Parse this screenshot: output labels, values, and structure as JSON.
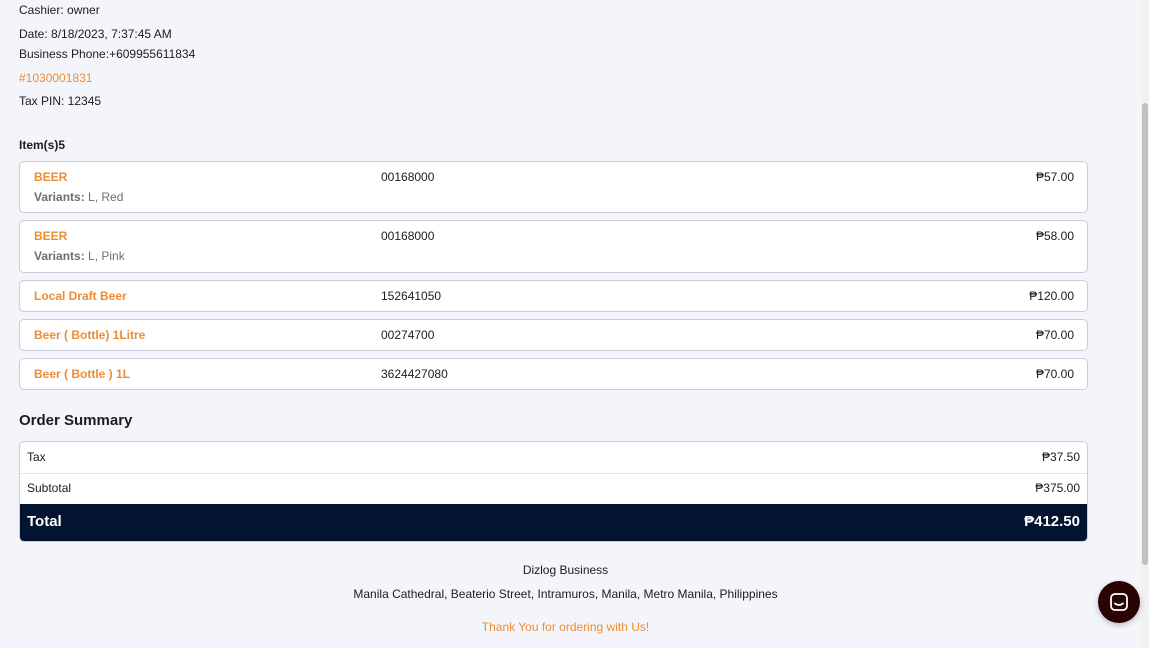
{
  "receipt": {
    "cashier": "Cashier: owner",
    "date": "Date: 8/18/2023, 7:37:45 AM",
    "phone": "Business Phone:+609955611834",
    "order_number": "#1030001831",
    "tax_pin": "Tax PIN: 12345"
  },
  "items_title": "Item(s)5",
  "variants_label": "Variants:",
  "items": [
    {
      "name": "BEER",
      "code": "00168000",
      "price": "₱57.00",
      "variants": "L, Red"
    },
    {
      "name": "BEER",
      "code": "00168000",
      "price": "₱58.00",
      "variants": "L, Pink"
    },
    {
      "name": "Local Draft Beer",
      "code": "152641050",
      "price": "₱120.00"
    },
    {
      "name": "Beer ( Bottle) 1Litre",
      "code": "00274700",
      "price": "₱70.00"
    },
    {
      "name": "Beer ( Bottle ) 1L",
      "code": "3624427080",
      "price": "₱70.00"
    }
  ],
  "summary": {
    "title": "Order Summary",
    "tax_label": "Tax",
    "tax_value": "₱37.50",
    "subtotal_label": "Subtotal",
    "subtotal_value": "₱375.00",
    "total_label": "Total",
    "total_value": "₱412.50"
  },
  "footer": {
    "business_name": "Dizlog Business",
    "address": "Manila Cathedral, Beaterio Street, Intramuros, Manila, Metro Manila, Philippines",
    "thanks": "Thank You for ordering with Us!"
  },
  "icons": {
    "chat": "chat-bubble-icon"
  },
  "colors": {
    "accent": "#ee8c34",
    "total_bar": "#031430",
    "chat_button": "#2a0303"
  }
}
